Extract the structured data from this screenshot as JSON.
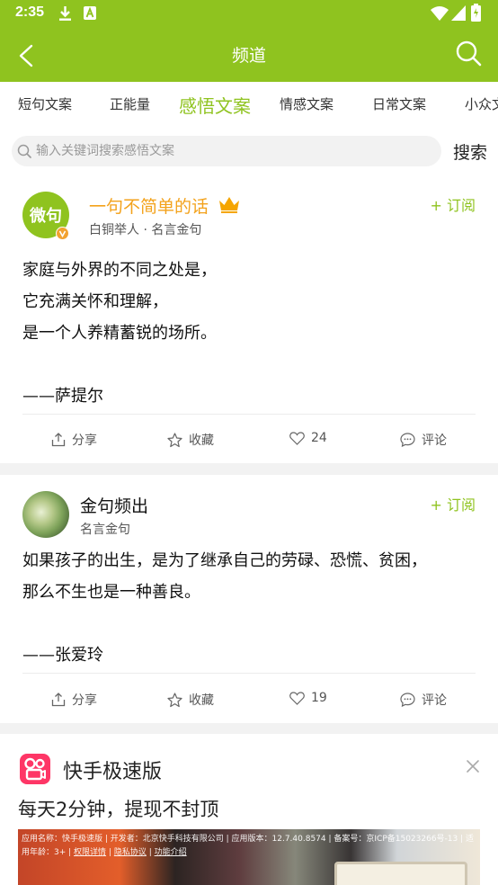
{
  "status_bar": {
    "time": "2:35",
    "icons": [
      "download-icon",
      "a-badge-icon",
      "wifi-icon",
      "cellular-signal-icon",
      "battery-icon"
    ]
  },
  "app_bar": {
    "title": "频道",
    "back_icon": "back-arrow-icon",
    "search_icon": "search-icon"
  },
  "tabs": [
    {
      "label": "短句文案",
      "active": false
    },
    {
      "label": "正能量",
      "active": false
    },
    {
      "label": "感悟文案",
      "active": true
    },
    {
      "label": "情感文案",
      "active": false
    },
    {
      "label": "日常文案",
      "active": false
    },
    {
      "label": "小众文",
      "active": false
    }
  ],
  "search": {
    "placeholder": "输入关键词搜索感悟文案",
    "button_label": "搜索"
  },
  "posts": [
    {
      "avatar_text": "微句",
      "verified": true,
      "author": "一句不简单的话",
      "author_badge": "crown-icon",
      "meta": "白铜举人 · 名言金句",
      "subscribe_label": "+ 订阅",
      "content": "家庭与外界的不同之处是，\n它充满关怀和理解，\n是一个人养精蓄锐的场所。\n\n——萨提尔",
      "actions": {
        "share": "分享",
        "favorite": "收藏",
        "likes": "24",
        "comment": "评论"
      }
    },
    {
      "avatar_text": "",
      "verified": false,
      "author": "金句频出",
      "author_badge": "",
      "meta": "名言金句",
      "subscribe_label": "+ 订阅",
      "content": "如果孩子的出生，是为了继承自己的劳碌、恐慌、贫困，\n那么不生也是一种善良。\n\n——张爱玲",
      "actions": {
        "share": "分享",
        "favorite": "收藏",
        "likes": "19",
        "comment": "评论"
      }
    }
  ],
  "ad": {
    "app_name": "快手极速版",
    "slogan": "每天2分钟，提现不封顶",
    "info_text": "应用名称：快手极速版 | 开发者：北京快手科技有限公司 | 应用版本：12.7.40.8574 | 备案号：京ICP备15023266号-13 | 适用年龄：3+ | ",
    "links": [
      "权限详情",
      "隐私协议",
      "功能介绍"
    ],
    "brand_color": "#fe3666"
  },
  "colors": {
    "accent": "#8fc31f",
    "crown": "#f5a500",
    "author_gold": "#f3a21b",
    "verified_badge": "#f2a230"
  }
}
